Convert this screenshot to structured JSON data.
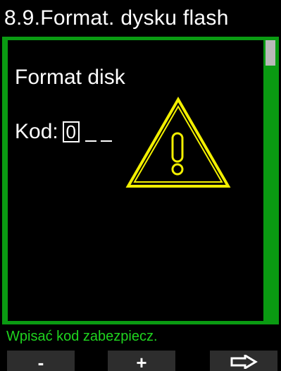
{
  "header": {
    "title": "8.9.Format. dysku flash"
  },
  "main": {
    "heading": "Format disk",
    "code": {
      "label": "Kod:",
      "digit": "0",
      "placeholders": [
        "_",
        "_"
      ]
    },
    "warning_icon": "warning-triangle-icon"
  },
  "status_text": "Wpisać kod zabezpiecz.",
  "softkeys": {
    "left_label": "-",
    "middle_label": "+",
    "right_icon": "arrow-right-icon"
  },
  "colors": {
    "frame": "#0a9b12",
    "status_text": "#1fd41f",
    "warning": "#f3f000",
    "softkey_bg": "#2d2d2d"
  }
}
